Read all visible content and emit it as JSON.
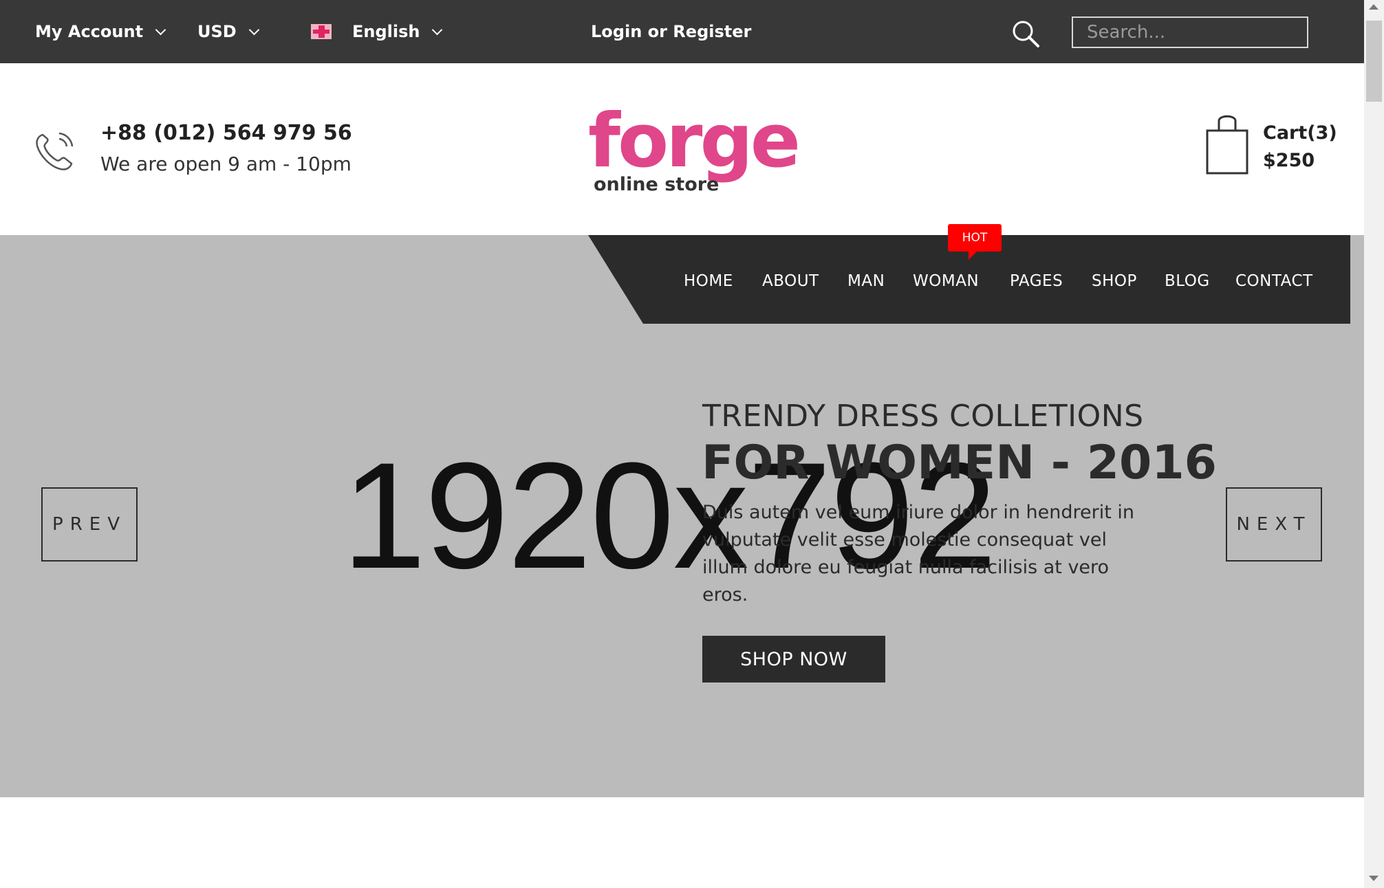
{
  "topbar": {
    "account": "My Account",
    "currency": "USD",
    "language": "English",
    "login": "Login or Register",
    "search_placeholder": "Search..."
  },
  "header": {
    "phone": "+88 (012) 564 979 56",
    "hours": "We are open 9 am - 10pm",
    "logo_main": "forge",
    "logo_sub": "online store",
    "cart_label": "Cart(3)",
    "cart_total": "$250"
  },
  "nav": {
    "items": [
      "HOME",
      "ABOUT",
      "MAN",
      "WOMAN",
      "PAGES",
      "SHOP",
      "BLOG",
      "CONTACT"
    ],
    "hot_badge": "HOT"
  },
  "slider": {
    "placeholder": "1920x792",
    "subtitle": "TRENDY DRESS COLLETIONS",
    "title": "FOR WOMEN - 2016",
    "description": "Duis autem vel eum iriure dolor in hendrerit in vulputate velit esse molestie consequat vel illum dolore eu feugiat nulla facilisis at vero eros.",
    "cta": "SHOP NOW",
    "prev": "PREV",
    "next": "NEXT"
  },
  "colors": {
    "topbar": "#383838",
    "nav": "#2b2b2b",
    "hero_bg": "#bbbbbb",
    "brand": "#e0468a",
    "hot": "#ff0000"
  }
}
